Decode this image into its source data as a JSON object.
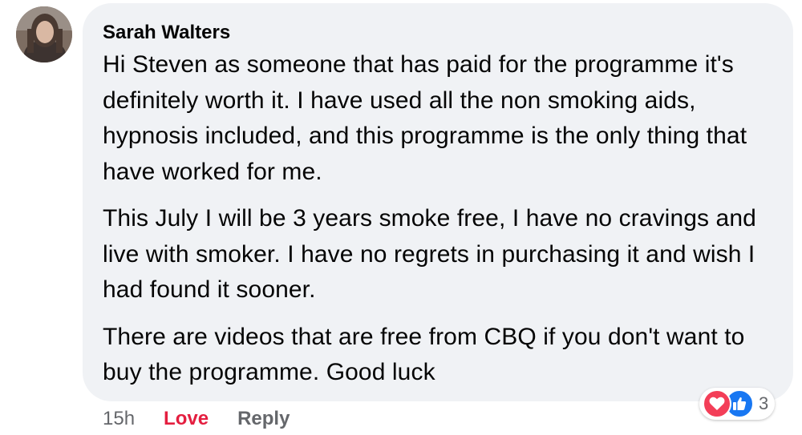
{
  "comment": {
    "author": "Sarah Walters",
    "paragraphs": [
      "Hi Steven as someone that has paid for the programme it's definitely worth it. I have used all the non smoking aids, hypnosis included, and this programme is the only thing that have worked for me.",
      "This July I will be 3 years smoke free, I have no cravings and live with smoker. I have no regrets in purchasing it and wish I had found it sooner.",
      "There are videos that are free from CBQ if you don't want to buy the programme. Good luck"
    ]
  },
  "actions": {
    "time": "15h",
    "love_label": "Love",
    "reply_label": "Reply"
  },
  "reactions": {
    "icons": [
      "heart-icon",
      "thumbs-up-icon"
    ],
    "count": "3"
  },
  "colors": {
    "bubble_bg": "#f0f2f5",
    "love": "#e41e3f",
    "muted": "#65676b",
    "like_blue": "#1877f2",
    "heart_red": "#f33e58"
  }
}
